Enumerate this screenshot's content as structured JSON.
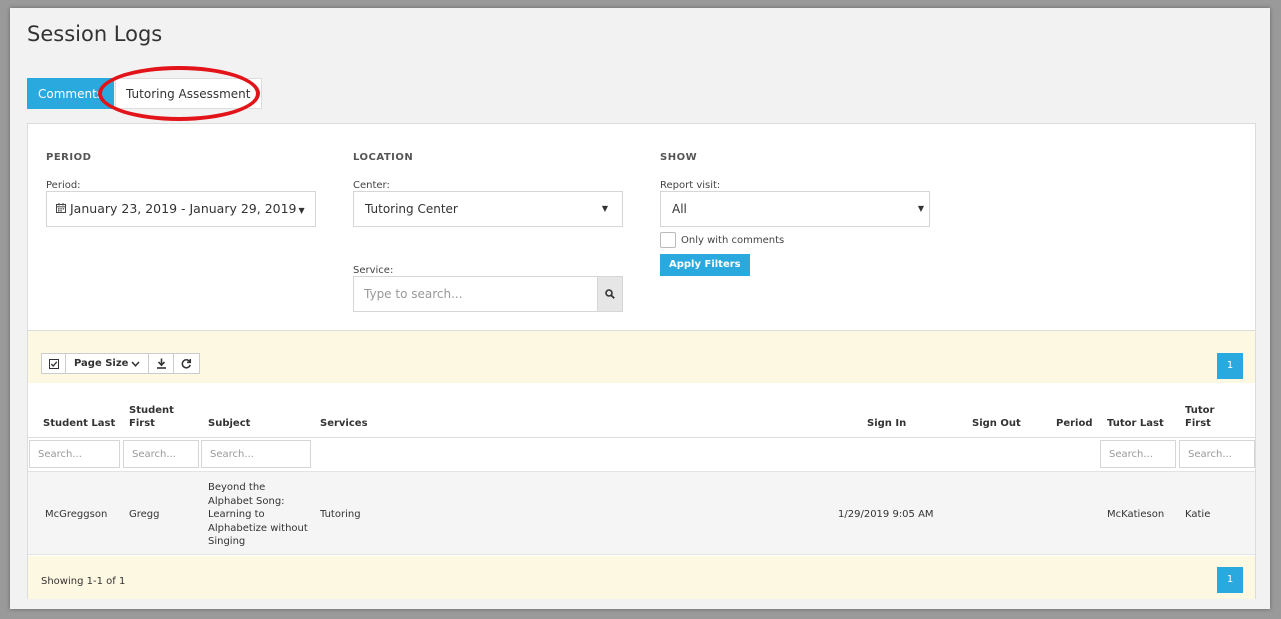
{
  "page": {
    "title": "Session Logs",
    "tabs": [
      {
        "label": "Comments",
        "active": true
      },
      {
        "label": "Tutoring Assessment",
        "active": false
      }
    ]
  },
  "filters": {
    "period": {
      "heading": "PERIOD",
      "label": "Period:",
      "value": "January 23, 2019 - January 29, 2019",
      "icon": "calendar-icon"
    },
    "location": {
      "heading": "LOCATION",
      "center_label": "Center:",
      "center_value": "Tutoring Center",
      "service_label": "Service:",
      "service_placeholder": "Type to search...",
      "search_icon": "search-icon"
    },
    "show": {
      "heading": "SHOW",
      "report_label": "Report visit:",
      "report_value": "All",
      "only_comments_label": "Only with comments",
      "only_comments_checked": false,
      "apply_label": "Apply Filters"
    }
  },
  "toolbar": {
    "page_size_label": "Page Size",
    "icons": [
      "select-all-checkbox-icon",
      "chevron-down-icon",
      "download-icon",
      "refresh-icon"
    ],
    "current_page": "1"
  },
  "table": {
    "columns": {
      "student_last": "Student Last",
      "student_first_1": "Student",
      "student_first_2": "First",
      "subject": "Subject",
      "services": "Services",
      "sign_in": "Sign In",
      "sign_out": "Sign Out",
      "period": "Period",
      "tutor_last": "Tutor Last",
      "tutor_first_1": "Tutor",
      "tutor_first_2": "First"
    },
    "search_placeholder": "Search...",
    "rows": [
      {
        "student_last": "McGreggson",
        "student_first": "Gregg",
        "subject_lines": [
          "Beyond the",
          "Alphabet Song:",
          "Learning to",
          "Alphabetize without",
          "Singing"
        ],
        "services": "Tutoring",
        "sign_in": "1/29/2019 9:05 AM",
        "sign_out": "",
        "period": "",
        "tutor_last": "McKatieson",
        "tutor_first": "Katie"
      }
    ]
  },
  "footer": {
    "showing": "Showing 1-1 of 1",
    "current_page": "1"
  },
  "colors": {
    "accent": "#2aa9df",
    "highlight": "#e2141a",
    "toolbar_bg": "#fdf8e1"
  }
}
